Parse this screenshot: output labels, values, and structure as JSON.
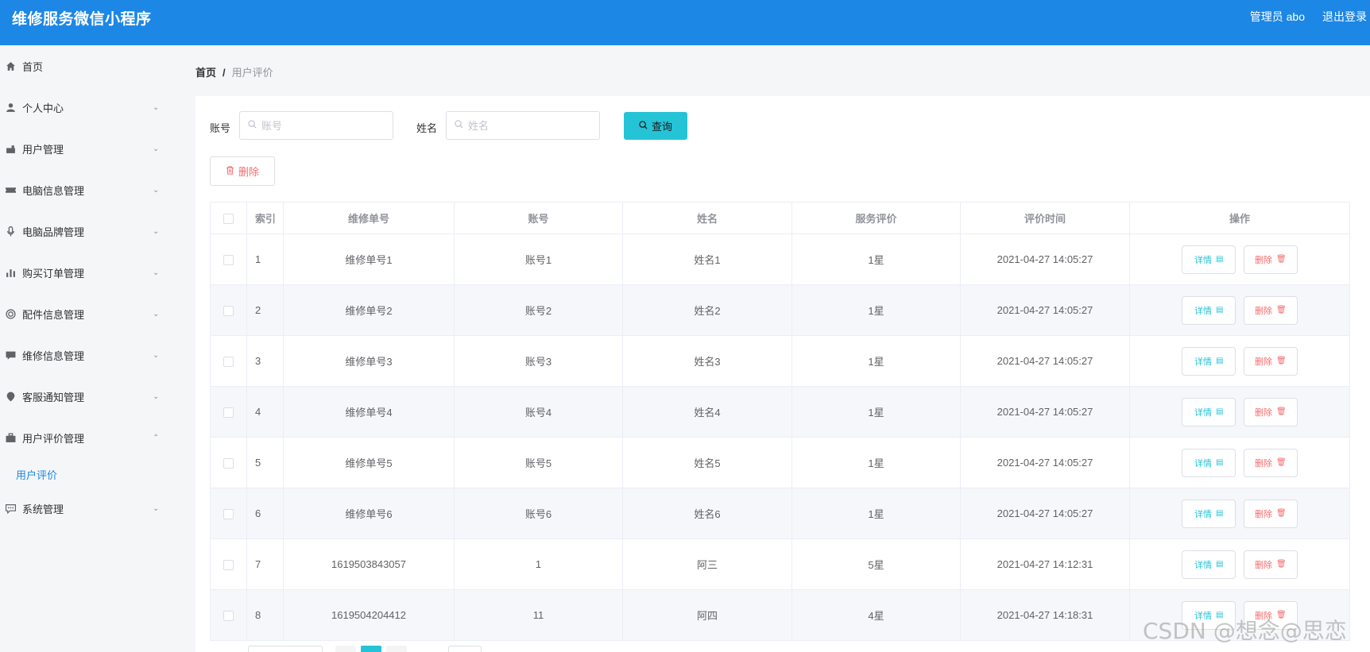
{
  "header": {
    "app_title": "维修服务微信小程序",
    "user_label": "管理员 abo",
    "logout_label": "退出登录"
  },
  "sidebar": {
    "items": [
      {
        "label": "首页",
        "icon": "home-icon",
        "has_arrow": false
      },
      {
        "label": "个人中心",
        "icon": "user-icon",
        "has_arrow": true,
        "expanded": false
      },
      {
        "label": "用户管理",
        "icon": "user-manage-icon",
        "has_arrow": true,
        "expanded": false
      },
      {
        "label": "电脑信息管理",
        "icon": "ticket-icon",
        "has_arrow": true,
        "expanded": false
      },
      {
        "label": "电脑品牌管理",
        "icon": "microphone-icon",
        "has_arrow": true,
        "expanded": false
      },
      {
        "label": "购买订单管理",
        "icon": "bar-chart-icon",
        "has_arrow": true,
        "expanded": false
      },
      {
        "label": "配件信息管理",
        "icon": "target-icon",
        "has_arrow": true,
        "expanded": false
      },
      {
        "label": "维修信息管理",
        "icon": "message-icon",
        "has_arrow": true,
        "expanded": false
      },
      {
        "label": "客服通知管理",
        "icon": "pin-icon",
        "has_arrow": true,
        "expanded": false
      },
      {
        "label": "用户评价管理",
        "icon": "briefcase-icon",
        "has_arrow": true,
        "expanded": true
      },
      {
        "label": "系统管理",
        "icon": "chat-icon",
        "has_arrow": true,
        "expanded": false
      }
    ],
    "submenu_active": "用户评价"
  },
  "breadcrumb": {
    "home": "首页",
    "separator": "/",
    "current": "用户评价"
  },
  "search": {
    "account_label": "账号",
    "account_placeholder": "账号",
    "account_value": "",
    "name_label": "姓名",
    "name_placeholder": "姓名",
    "name_value": "",
    "query_label": "查询"
  },
  "toolbar": {
    "delete_label": "删除"
  },
  "table": {
    "columns": [
      "索引",
      "维修单号",
      "账号",
      "姓名",
      "服务评价",
      "评价时间",
      "操作"
    ],
    "detail_label": "详情",
    "delete_label": "删除",
    "rows": [
      {
        "index": "1",
        "order_no": "维修单号1",
        "account": "账号1",
        "name": "姓名1",
        "rating": "1星",
        "time": "2021-04-27 14:05:27"
      },
      {
        "index": "2",
        "order_no": "维修单号2",
        "account": "账号2",
        "name": "姓名2",
        "rating": "1星",
        "time": "2021-04-27 14:05:27"
      },
      {
        "index": "3",
        "order_no": "维修单号3",
        "account": "账号3",
        "name": "姓名3",
        "rating": "1星",
        "time": "2021-04-27 14:05:27"
      },
      {
        "index": "4",
        "order_no": "维修单号4",
        "account": "账号4",
        "name": "姓名4",
        "rating": "1星",
        "time": "2021-04-27 14:05:27"
      },
      {
        "index": "5",
        "order_no": "维修单号5",
        "account": "账号5",
        "name": "姓名5",
        "rating": "1星",
        "time": "2021-04-27 14:05:27"
      },
      {
        "index": "6",
        "order_no": "维修单号6",
        "account": "账号6",
        "name": "姓名6",
        "rating": "1星",
        "time": "2021-04-27 14:05:27"
      },
      {
        "index": "7",
        "order_no": "1619503843057",
        "account": "1",
        "name": "阿三",
        "rating": "5星",
        "time": "2021-04-27 14:12:31"
      },
      {
        "index": "8",
        "order_no": "1619504204412",
        "account": "11",
        "name": "阿四",
        "rating": "4星",
        "time": "2021-04-27 14:18:31"
      }
    ]
  },
  "watermark": "CSDN @想念@思恋",
  "colors": {
    "header_bg": "#1c87e5",
    "accent": "#25c3d6",
    "danger": "#f56c6c"
  }
}
